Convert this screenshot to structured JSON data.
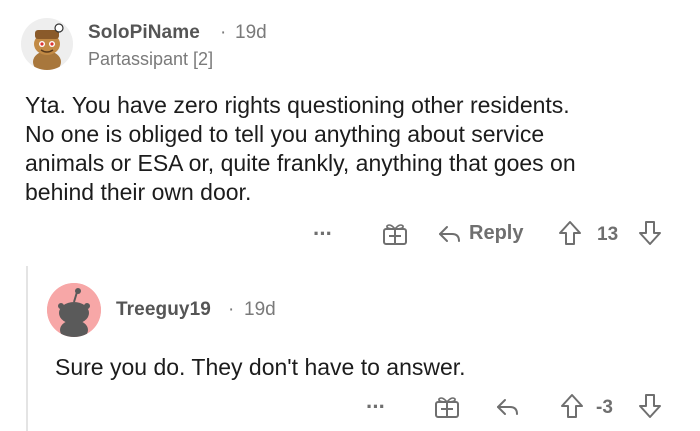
{
  "comment": {
    "username": "SoloPiName",
    "age": "19d",
    "flair": "Partassipant [2]",
    "body_lines": [
      "Yta. You have zero rights questioning other residents.",
      "No one is obliged to tell you anything about service",
      "animals or ESA or, quite frankly, anything that goes on",
      "behind their own door."
    ],
    "more_label": "···",
    "reply_label": "Reply",
    "score": "13"
  },
  "reply": {
    "username": "Treeguy19",
    "age": "19d",
    "body": "Sure you do. They don't have to answer.",
    "more_label": "···",
    "score": "-3"
  },
  "separator": "·",
  "colors": {
    "text": "#1c1c1c",
    "meta": "#7a7a7a",
    "action": "#6f6f6f",
    "avatar2_bg": "#f7a7a7",
    "avatar2_fg": "#5a5a5a"
  },
  "icons": [
    "more-icon",
    "gift-icon",
    "reply-arrow-icon",
    "upvote-icon",
    "downvote-icon"
  ]
}
